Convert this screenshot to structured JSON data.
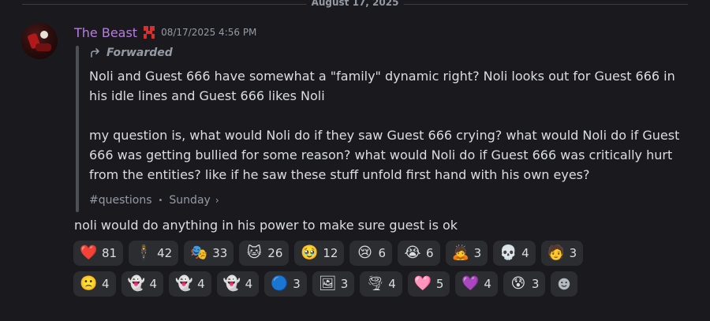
{
  "date_divider": "August 17, 2025",
  "message": {
    "username": "The Beast",
    "timestamp": "08/17/2025 4:56 PM",
    "forwarded_label": "Forwarded",
    "quoted_paragraphs": [
      "Noli and Guest 666 have somewhat a \"family\" dynamic right? Noli looks out for Guest 666 in his idle lines and Guest 666 likes Noli",
      "my question is, what would Noli do if they saw Guest 666 crying? what would Noli do if Guest 666 was getting bullied for some reason? what would Noli do if Guest 666 was critically hurt from the entities? like if he saw these stuff unfold first hand with his own eyes?"
    ],
    "forward_source": {
      "channel": "#questions",
      "day": "Sunday"
    },
    "reply_text": "noli would do anything in his power to make sure guest is ok"
  },
  "reactions_row1": [
    {
      "icon": "red-heart-icon",
      "emoji": "❤️",
      "count": "81"
    },
    {
      "icon": "custom-figure-icon",
      "emoji": "🕴",
      "count": "42"
    },
    {
      "icon": "performing-arts-icon",
      "emoji": "🎭",
      "count": "33"
    },
    {
      "icon": "custom-cat-icon",
      "emoji": "🐱",
      "count": "26"
    },
    {
      "icon": "pleading-face-icon",
      "emoji": "🥹",
      "count": "12"
    },
    {
      "icon": "crying-face-icon",
      "emoji": "😢",
      "count": "6"
    },
    {
      "icon": "loudly-crying-face-icon",
      "emoji": "😭",
      "count": "6"
    },
    {
      "icon": "person-bowing-icon",
      "emoji": "🙇",
      "count": "3"
    },
    {
      "icon": "custom-skull-icon",
      "emoji": "💀",
      "count": "4"
    },
    {
      "icon": "custom-photo-icon",
      "emoji": "🧑",
      "count": "3"
    }
  ],
  "reactions_row2": [
    {
      "icon": "frowning-face-icon",
      "emoji": "🙁",
      "count": "4"
    },
    {
      "icon": "custom-crying-ghost-icon",
      "emoji": "👻",
      "count": "4"
    },
    {
      "icon": "custom-crying-ghost-2-icon",
      "emoji": "👻",
      "count": "4"
    },
    {
      "icon": "custom-crying-ghost-3-icon",
      "emoji": "👻",
      "count": "4"
    },
    {
      "icon": "custom-blue-ball-icon",
      "emoji": "🔵",
      "count": "3"
    },
    {
      "icon": "custom-gold-frame-icon",
      "emoji": "🖼",
      "count": "3"
    },
    {
      "icon": "custom-smoke-icon",
      "emoji": "🌪",
      "count": "4"
    },
    {
      "icon": "pink-heart-icon",
      "emoji": "🩷",
      "count": "5"
    },
    {
      "icon": "purple-heart-icon",
      "emoji": "💜",
      "count": "4"
    },
    {
      "icon": "custom-nervous-icon",
      "emoji": "😰",
      "count": "3"
    }
  ],
  "add_reaction_icon": "add-reaction-icon",
  "colors": {
    "background": "#1a1a1e",
    "username": "#b77ce0",
    "reaction_bg": "#2b2d31",
    "muted_text": "#949ba4"
  }
}
